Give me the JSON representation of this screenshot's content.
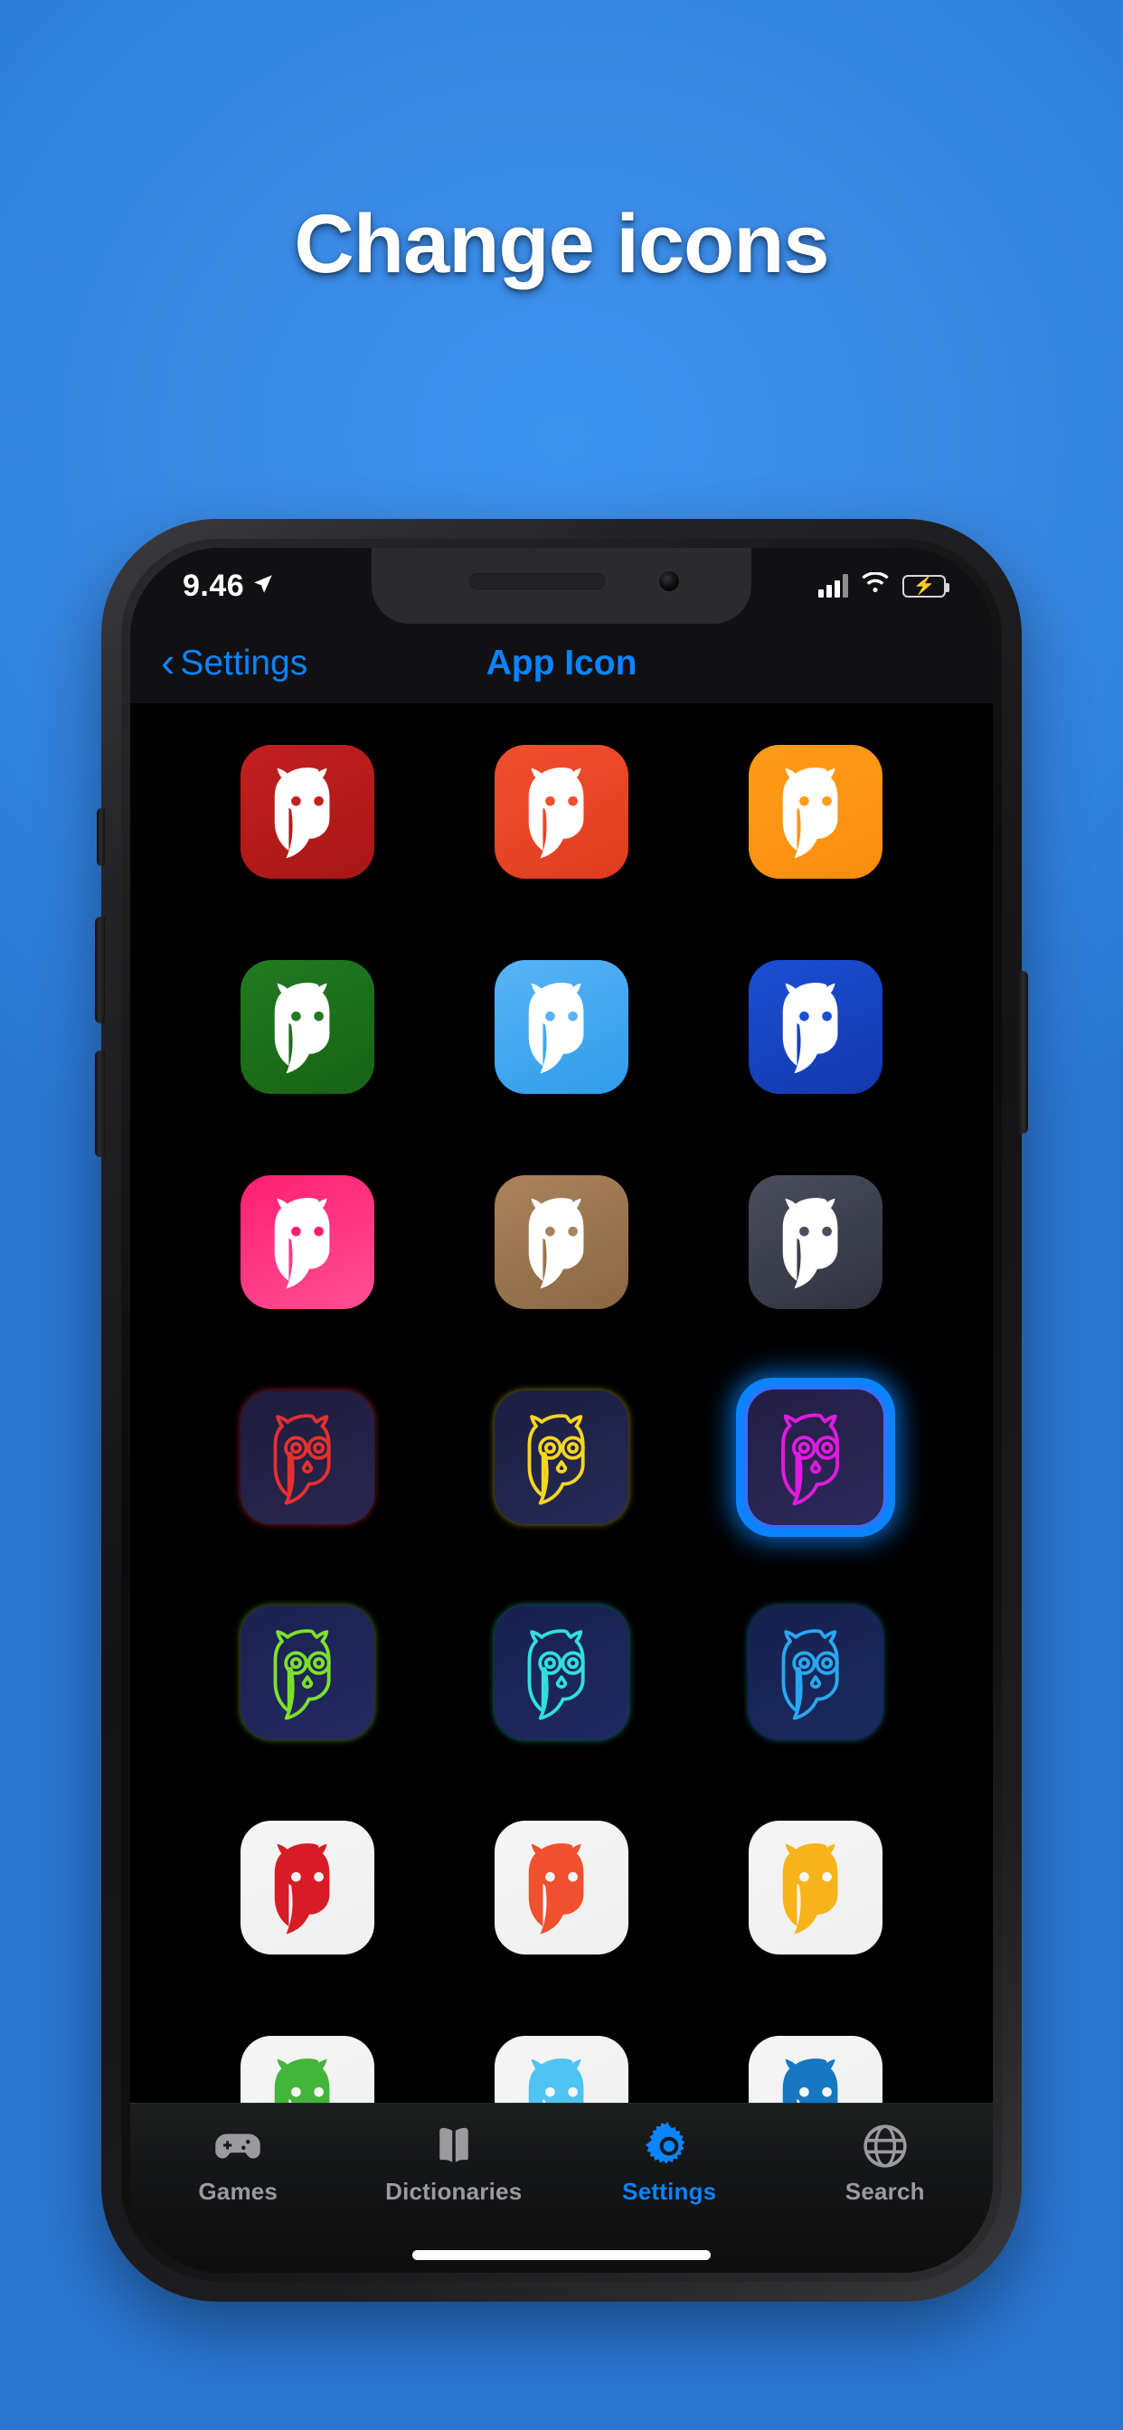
{
  "headline": "Change icons",
  "colors": {
    "accent": "#0a84ff",
    "background": "#2f7fdd",
    "screen_background": "#000000",
    "battery_green": "#35c759",
    "tab_inactive": "#9a9a9f"
  },
  "status_bar": {
    "time": "9.46",
    "location_icon": "location-arrow-icon",
    "cellular_icon": "cellular-bars-icon",
    "wifi_icon": "wifi-icon",
    "battery_icon": "battery-charging-icon",
    "battery_bolt": "⚡"
  },
  "nav_bar": {
    "back_chevron": "‹",
    "back_label": "Settings",
    "title": "App Icon"
  },
  "icon_grid": {
    "selected_index": 11,
    "icons": [
      {
        "name": "owl-icon-dark-red",
        "style": "solid",
        "bg_from": "#c32020",
        "bg_to": "#a81616",
        "owl": "#ffffff"
      },
      {
        "name": "owl-icon-red-orange",
        "style": "solid",
        "bg_from": "#f0502e",
        "bg_to": "#e03b1e",
        "owl": "#ffffff"
      },
      {
        "name": "owl-icon-orange",
        "style": "solid",
        "bg_from": "#ff9d18",
        "bg_to": "#f98d0c",
        "owl": "#ffffff"
      },
      {
        "name": "owl-icon-green",
        "style": "solid",
        "bg_from": "#217a20",
        "bg_to": "#176415",
        "owl": "#ffffff"
      },
      {
        "name": "owl-icon-light-blue",
        "style": "solid",
        "bg_from": "#58b4f5",
        "bg_to": "#2f9ceb",
        "owl": "#ffffff"
      },
      {
        "name": "owl-icon-dark-blue",
        "style": "solid",
        "bg_from": "#1b4fd4",
        "bg_to": "#1338ae",
        "owl": "#ffffff"
      },
      {
        "name": "owl-icon-pink",
        "style": "solid",
        "bg_from": "#ff1f72",
        "bg_to": "#ff4f92",
        "owl": "#ffffff"
      },
      {
        "name": "owl-icon-brown",
        "style": "solid",
        "bg_from": "#a9835c",
        "bg_to": "#8a6743",
        "owl": "#ffffff"
      },
      {
        "name": "owl-icon-slate",
        "style": "solid",
        "bg_from": "#4a4d5c",
        "bg_to": "#2f323e",
        "owl": "#ffffff"
      },
      {
        "name": "owl-icon-neon-red",
        "style": "outline",
        "bg_from": "#1e1b3c",
        "bg_to": "#2a2750",
        "owl": "#e63030"
      },
      {
        "name": "owl-icon-neon-yellow",
        "style": "outline",
        "bg_from": "#1b1e3f",
        "bg_to": "#272a57",
        "owl": "#f5d521"
      },
      {
        "name": "owl-icon-neon-magenta",
        "style": "outline",
        "bg_from": "#241e45",
        "bg_to": "#2d2a59",
        "owl": "#e01ae0"
      },
      {
        "name": "owl-icon-neon-green",
        "style": "outline",
        "bg_from": "#1b2150",
        "bg_to": "#232a63",
        "owl": "#7ee02a"
      },
      {
        "name": "owl-icon-neon-cyan",
        "style": "outline",
        "bg_from": "#172050",
        "bg_to": "#1f2a63",
        "owl": "#2fe0dc"
      },
      {
        "name": "owl-icon-neon-blue",
        "style": "outline",
        "bg_from": "#15204e",
        "bg_to": "#1c2a60",
        "owl": "#28a8f0"
      },
      {
        "name": "owl-icon-white-red",
        "style": "solid",
        "bg_from": "#f5f5f5",
        "bg_to": "#efefef",
        "owl": "#d81c26"
      },
      {
        "name": "owl-icon-white-orange",
        "style": "solid",
        "bg_from": "#f5f5f5",
        "bg_to": "#efefef",
        "owl": "#f0502e"
      },
      {
        "name": "owl-icon-white-yellow",
        "style": "solid",
        "bg_from": "#f5f5f5",
        "bg_to": "#efefef",
        "owl": "#f7b319"
      },
      {
        "name": "owl-icon-white-green",
        "style": "solid",
        "bg_from": "#f5f5f5",
        "bg_to": "#efefef",
        "owl": "#43b53a"
      },
      {
        "name": "owl-icon-white-lightblue",
        "style": "solid",
        "bg_from": "#f5f5f5",
        "bg_to": "#efefef",
        "owl": "#4fc4f2"
      },
      {
        "name": "owl-icon-white-blue",
        "style": "solid",
        "bg_from": "#f5f5f5",
        "bg_to": "#efefef",
        "owl": "#1677c2"
      }
    ]
  },
  "tab_bar": {
    "active_index": 2,
    "items": [
      {
        "label": "Games",
        "icon": "gamepad-icon"
      },
      {
        "label": "Dictionaries",
        "icon": "open-book-icon"
      },
      {
        "label": "Settings",
        "icon": "gear-icon"
      },
      {
        "label": "Search",
        "icon": "globe-icon"
      }
    ]
  }
}
